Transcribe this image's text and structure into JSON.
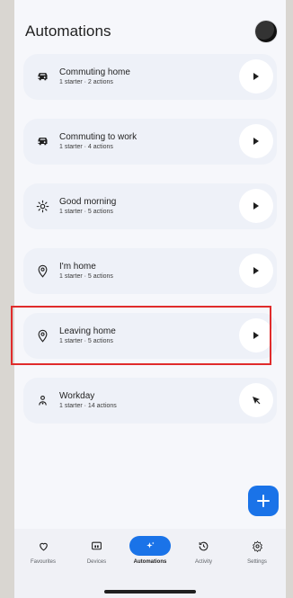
{
  "header": {
    "title": "Automations"
  },
  "automations": [
    {
      "name": "Commuting home",
      "subtitle": "1 starter · 2 actions",
      "icon": "car-icon"
    },
    {
      "name": "Commuting to work",
      "subtitle": "1 starter · 4 actions",
      "icon": "car-icon"
    },
    {
      "name": "Good morning",
      "subtitle": "1 starter · 5 actions",
      "icon": "sun-icon"
    },
    {
      "name": "I'm home",
      "subtitle": "1 starter · 5 actions",
      "icon": "location-pin-icon"
    },
    {
      "name": "Leaving home",
      "subtitle": "1 starter · 5 actions",
      "icon": "location-pin-icon"
    },
    {
      "name": "Workday",
      "subtitle": "1 starter · 14 actions",
      "icon": "person-pin-icon"
    }
  ],
  "nav": [
    {
      "label": "Favourites",
      "icon": "heart-icon",
      "active": false
    },
    {
      "label": "Devices",
      "icon": "devices-icon",
      "active": false
    },
    {
      "label": "Automations",
      "icon": "sparkle-icon",
      "active": true
    },
    {
      "label": "Activity",
      "icon": "history-icon",
      "active": false
    },
    {
      "label": "Settings",
      "icon": "gear-icon",
      "active": false
    }
  ],
  "colors": {
    "accent": "#1a73e8",
    "highlight": "#e02b2b",
    "card": "#eef1f8"
  }
}
